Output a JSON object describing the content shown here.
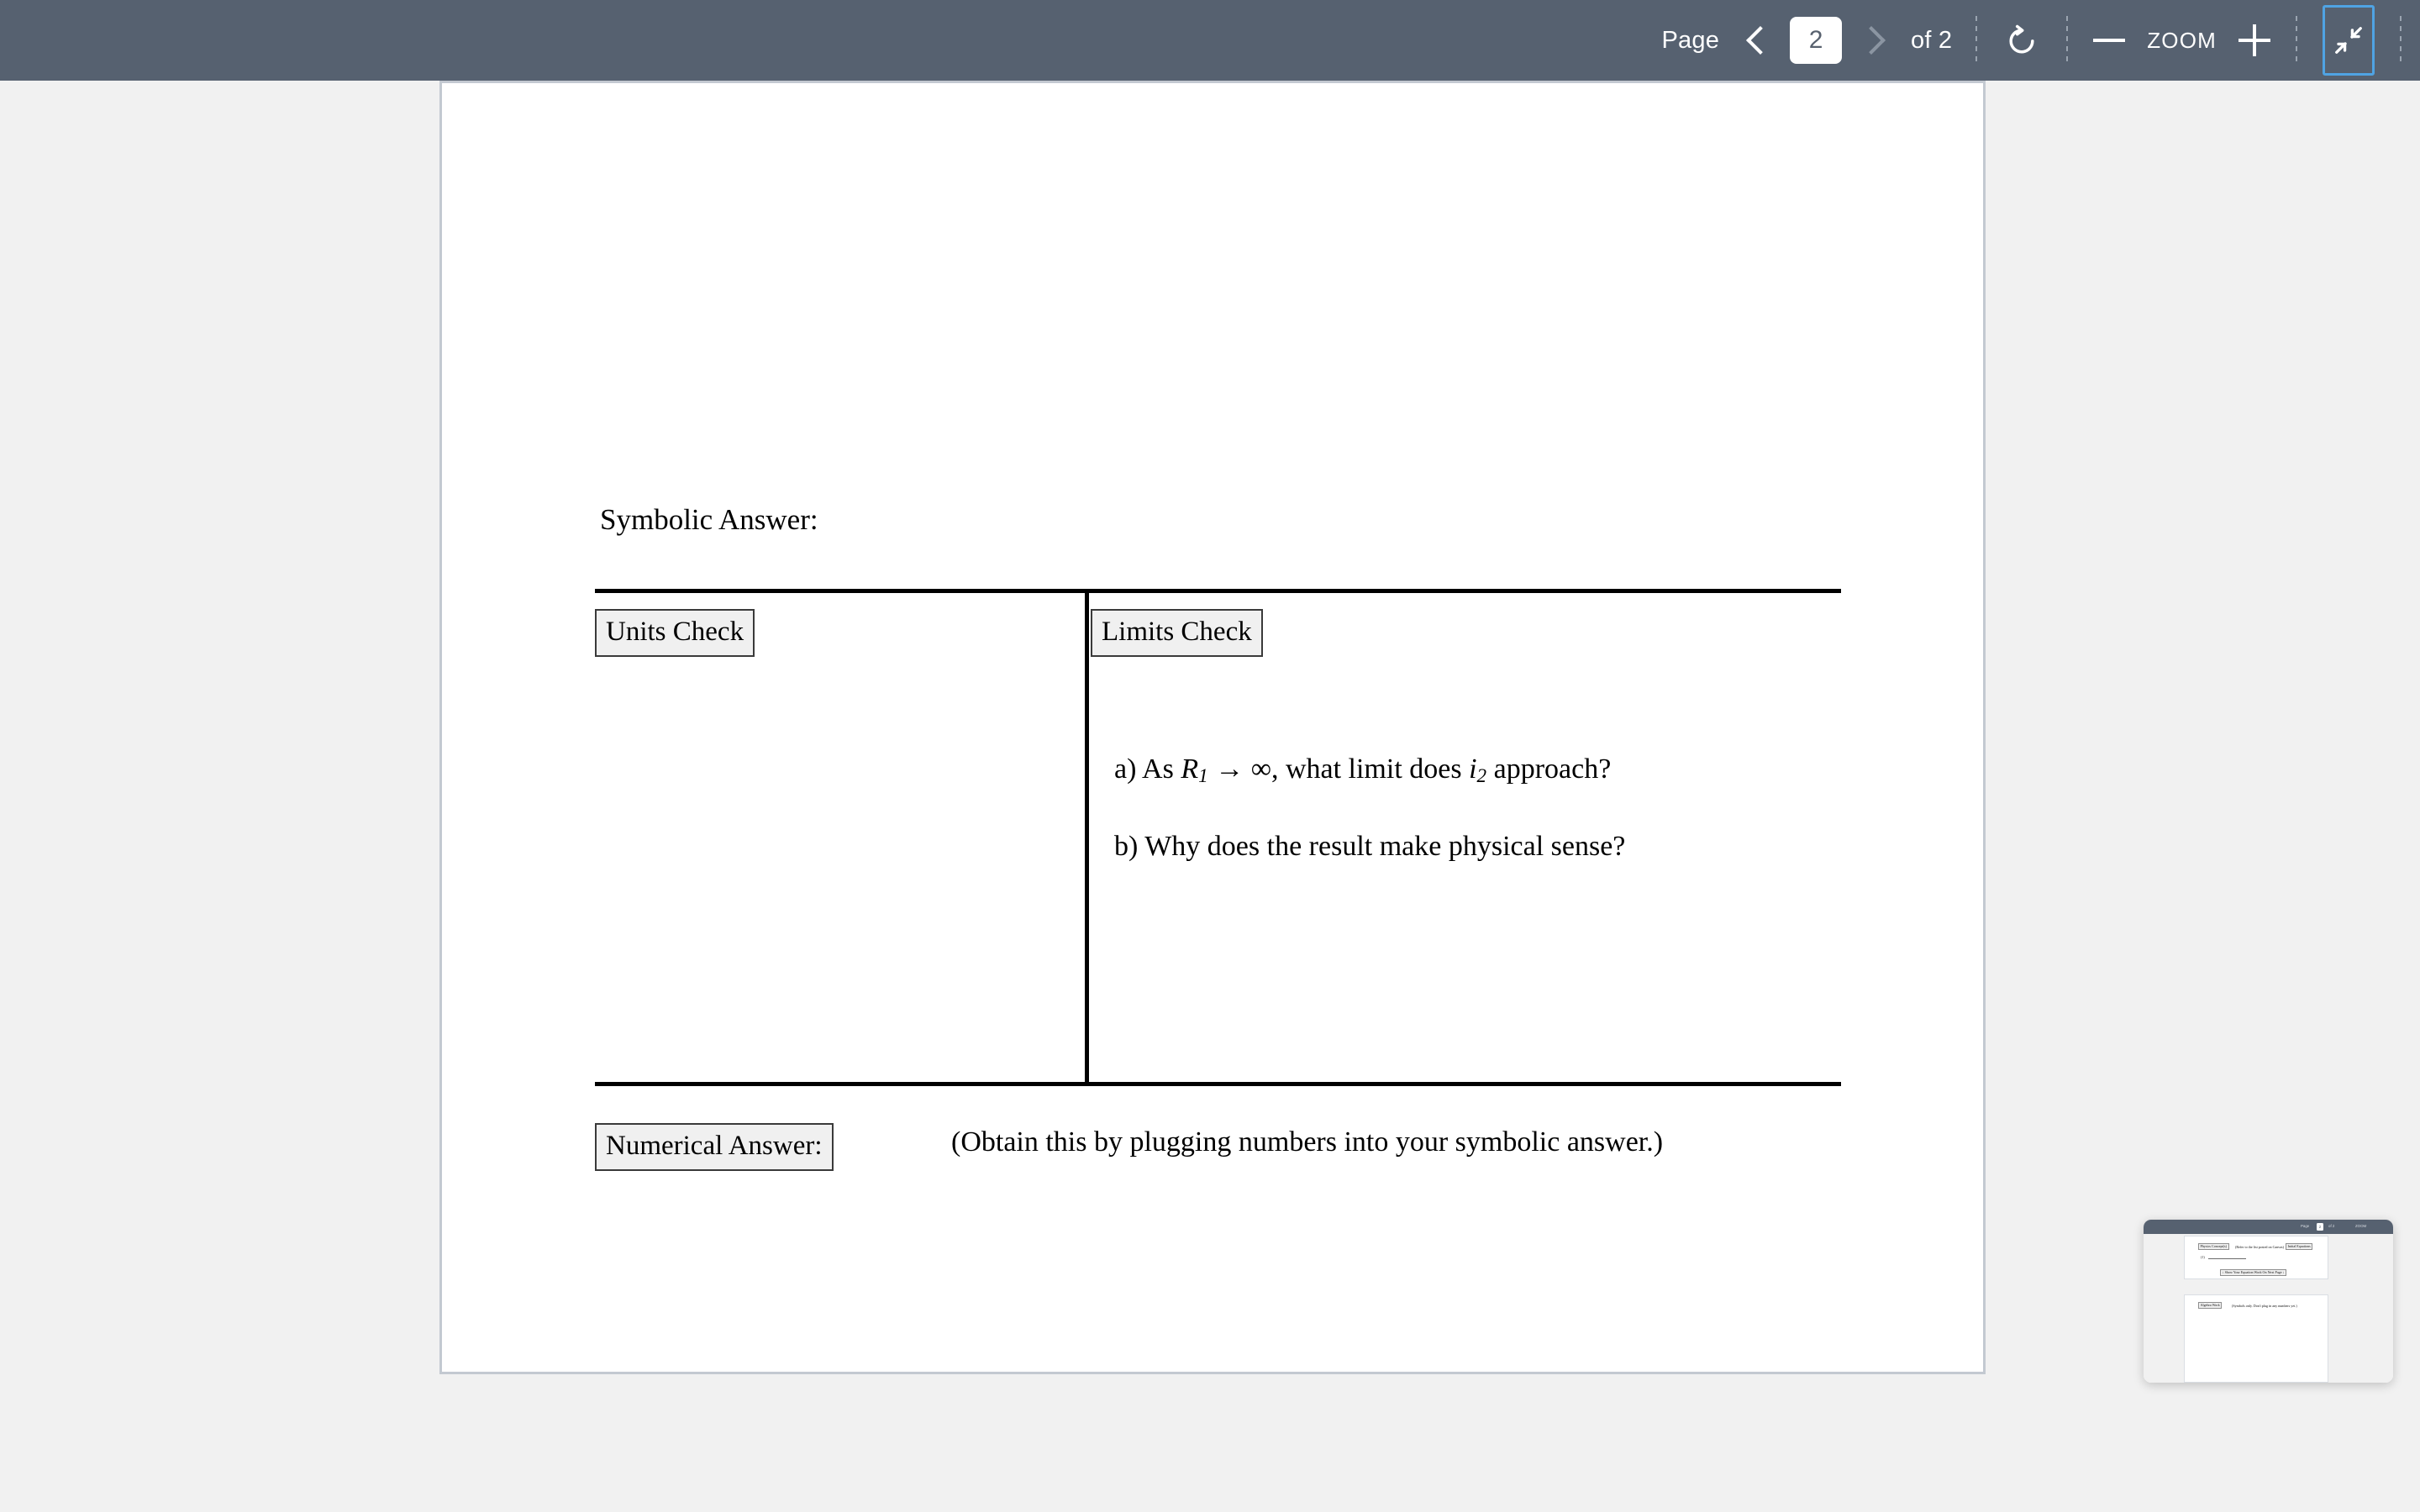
{
  "toolbar": {
    "page_label": "Page",
    "page_number_value": "2",
    "page_total_label": "of 2",
    "prev_page_icon": "chevron-left-icon",
    "next_page_icon": "chevron-right-icon",
    "rotate_icon": "rotate-clockwise-icon",
    "zoom_out_icon": "minus-icon",
    "zoom_label": "ZOOM",
    "zoom_in_icon": "plus-icon",
    "fullscreen_exit_icon": "collapse-arrows-icon",
    "background_color": "#566170",
    "focus_ring_color": "#4fa3e3"
  },
  "document": {
    "symbolic_answer_heading": "Symbolic Answer:",
    "units_check_label": "Units Check",
    "limits_check_label": "Limits Check",
    "limits_questions": [
      {
        "marker": "a)",
        "text_before": "As",
        "var1": "R",
        "var1_sub": "1",
        "arrow": "→",
        "infinity": "∞",
        "text_middle": ", what limit does",
        "var2": "i",
        "var2_sub": "2",
        "text_after": "approach?"
      },
      {
        "marker": "b)",
        "text": "Why does the result make physical sense?"
      }
    ],
    "numerical_answer_label": "Numerical Answer:",
    "numerical_answer_note": "(Obtain this by plugging numbers into your symbolic answer.)"
  },
  "thumbnail": {
    "toolbar_page_label": "Page",
    "toolbar_page_value": "2",
    "toolbar_page_total": "of 2",
    "toolbar_zoom_label": "ZOOM",
    "physics_concepts_chip": "Physics Concept(s)",
    "physics_concepts_note": "(Refer to the list posted on Canvas)",
    "initial_equations_chip": "Initial Equations",
    "list_item_marker": "(1)",
    "show_work_chip": "↓ Show Your Equation Work On Next Page ↓",
    "algebra_work_chip": "Algebra Work",
    "algebra_work_note": "(Symbols only. Don't plug in any numbers yet.)"
  }
}
